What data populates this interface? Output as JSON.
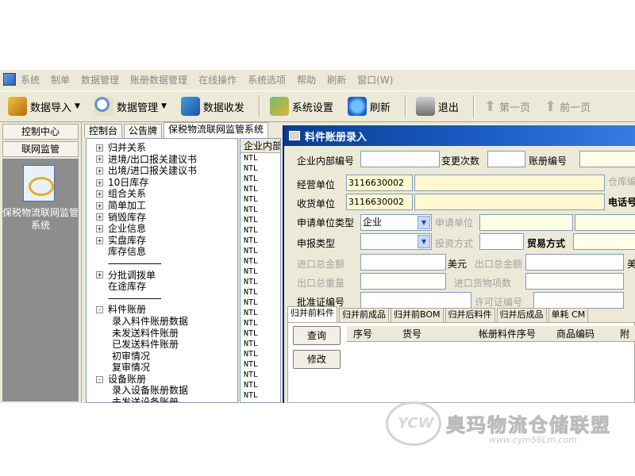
{
  "menubar": {
    "items": [
      "系统",
      "制单",
      "数据管理",
      "账册数据管理",
      "在线操作",
      "系统选项",
      "帮助",
      "刷新",
      "窗口(W)"
    ]
  },
  "toolbar": {
    "data_import": "数据导入",
    "data_manage": "数据管理",
    "data_send": "数据收发",
    "settings": "系统设置",
    "refresh": "刷新",
    "exit": "退出",
    "first_page": "第一页",
    "prev_page": "前一页"
  },
  "leftnav": {
    "tabs": [
      "控制中心",
      "联网监管"
    ],
    "system_label": "保税物流联网监管系统"
  },
  "doc_tabs": [
    "控制台",
    "公告牌",
    "保税物流联网监管系统"
  ],
  "tree": {
    "items": [
      {
        "label": "归并关系",
        "expand": "+"
      },
      {
        "label": "进境/出口报关建议书",
        "expand": "+"
      },
      {
        "label": "出境/进口报关建议书",
        "expand": "+"
      },
      {
        "label": "10日库存",
        "expand": "+"
      },
      {
        "label": "组合关系",
        "expand": "+"
      },
      {
        "label": "简单加工",
        "expand": "+"
      },
      {
        "label": "销毁库存",
        "expand": "+"
      },
      {
        "label": "企业信息",
        "expand": "+"
      },
      {
        "label": "实盘库存",
        "expand": "+"
      },
      {
        "label": "库存信息",
        "expand": ""
      },
      {
        "label": "--------------------",
        "expand": "",
        "sep": true
      },
      {
        "label": "分批调拨单",
        "expand": "+"
      },
      {
        "label": "在途库存",
        "expand": ""
      },
      {
        "label": "--------------------",
        "expand": "",
        "sep": true
      },
      {
        "label": "料件账册",
        "expand": "-"
      },
      {
        "label": "录入料件账册数据",
        "child": true
      },
      {
        "label": "未发送料件账册",
        "child": true
      },
      {
        "label": "已发送料件账册",
        "child": true
      },
      {
        "label": "初审情况",
        "child": true
      },
      {
        "label": "复审情况",
        "child": true
      },
      {
        "label": "设备账册",
        "expand": "-"
      },
      {
        "label": "录入设备账册数据",
        "child": true
      },
      {
        "label": "未发送设备账册",
        "child": true
      }
    ]
  },
  "listcol": {
    "header": "企业内部",
    "cells": [
      "NTL",
      "NTL",
      "NTL",
      "NTL",
      "NTL",
      "NTL",
      "NTL",
      "NTL",
      "NTL",
      "NTL",
      "NTL",
      "NTL",
      "NTL",
      "NTL",
      "NTL",
      "NTL",
      "NTL",
      "NTL",
      "NTL",
      "NTL",
      "NTL",
      "NTL",
      "NTL",
      "NTL"
    ]
  },
  "dialog": {
    "title": "料件账册录入",
    "labels": {
      "internal_no": "企业内部编号",
      "change_count": "变更次数",
      "book_no": "账册编号",
      "operator": "经营单位",
      "warehouse_no": "仓库编",
      "receiver": "收货单位",
      "phone": "电话号",
      "applicant_type": "申请单位类型",
      "applicant": "申请单位",
      "declare_type": "申报类型",
      "invest_mode": "投资方式",
      "trade_mode": "贸易方式",
      "import_total": "进口总金额",
      "usd": "美元",
      "export_total": "出口总金额",
      "usd_right": "美",
      "import_weight": "出口总重量",
      "import_items": "进口货物项数",
      "approval_no": "批准证编号",
      "license_no": "许可证编号"
    },
    "values": {
      "operator_code": "3116630002",
      "receiver_code": "3116630002",
      "applicant_type": "企业"
    },
    "inner_tabs": [
      "归并前料件",
      "归并前成品",
      "归并前BOM",
      "归并后料件",
      "归并后成品",
      "单耗 CM"
    ],
    "buttons": {
      "query": "查询",
      "modify": "修改"
    },
    "grid_headers": [
      "序号",
      "货号",
      "帐册料件序号",
      "商品编码",
      "附"
    ]
  },
  "watermark": {
    "title": "奥玛物流仓储联盟",
    "url": "www.cym56Lm.com"
  }
}
